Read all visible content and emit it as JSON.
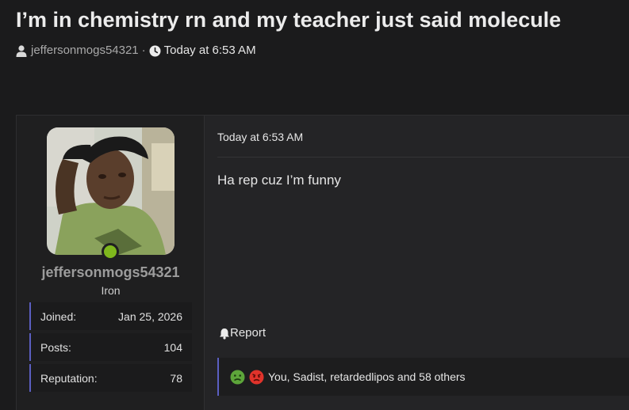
{
  "thread": {
    "title": "I’m in chemistry rn and my teacher just said molecule",
    "author": "jeffersonmogs54321",
    "separator": "·",
    "time": "Today at 6:53 AM"
  },
  "user": {
    "username": "jeffersonmogs54321",
    "rank": "Iron",
    "online_color": "#7fb81d",
    "stats": [
      {
        "label": "Joined:",
        "value": "Jan 25, 2026"
      },
      {
        "label": "Posts:",
        "value": "104"
      },
      {
        "label": "Reputation:",
        "value": "78"
      }
    ]
  },
  "post": {
    "date": "Today at 6:53 AM",
    "body": "Ha rep cuz I’m funny",
    "report_label": "Report",
    "reactions": {
      "icons": [
        "nauseated-face-icon",
        "angry-face-icon"
      ],
      "text": "You, Sadist, retardedlipos and 58 others"
    }
  },
  "colors": {
    "accent": "#5b5fc2",
    "background": "#1b1b1c"
  }
}
